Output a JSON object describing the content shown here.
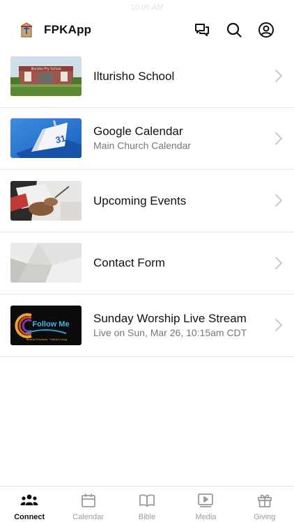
{
  "status_bar": {
    "time": "10:05 AM"
  },
  "header": {
    "title": "FPKApp",
    "icons": [
      "chat-icon",
      "search-icon",
      "profile-icon"
    ]
  },
  "list": [
    {
      "title": "Ilturisho School",
      "subtitle": "",
      "thumbnail": "school-photo"
    },
    {
      "title": "Google Calendar",
      "subtitle": "Main Church Calendar",
      "thumbnail": "calendar-graphic"
    },
    {
      "title": "Upcoming Events",
      "subtitle": "",
      "thumbnail": "writing-photo"
    },
    {
      "title": "Contact Form",
      "subtitle": "",
      "thumbnail": "paper-photo"
    },
    {
      "title": "Sunday Worship Live Stream",
      "subtitle": "Live on Sun, Mar 26, 10:15am CDT",
      "thumbnail": "follow-me-graphic"
    }
  ],
  "thumb_text": {
    "school_sign": "Ilturisho Pry School",
    "calendar_num": "31",
    "follow_title": "Follow Me",
    "follow_sub": "Biblical Practices · Faithful Living"
  },
  "tabs": [
    {
      "label": "Connect",
      "icon": "connect-icon",
      "active": true
    },
    {
      "label": "Calendar",
      "icon": "calendar-icon",
      "active": false
    },
    {
      "label": "Bible",
      "icon": "bible-icon",
      "active": false
    },
    {
      "label": "Media",
      "icon": "media-icon",
      "active": false
    },
    {
      "label": "Giving",
      "icon": "gift-icon",
      "active": false
    }
  ],
  "colors": {
    "active_tab": "#111111",
    "inactive_tab": "#9a9a9a",
    "divider": "#e6e6e6",
    "subtitle": "#777777"
  }
}
